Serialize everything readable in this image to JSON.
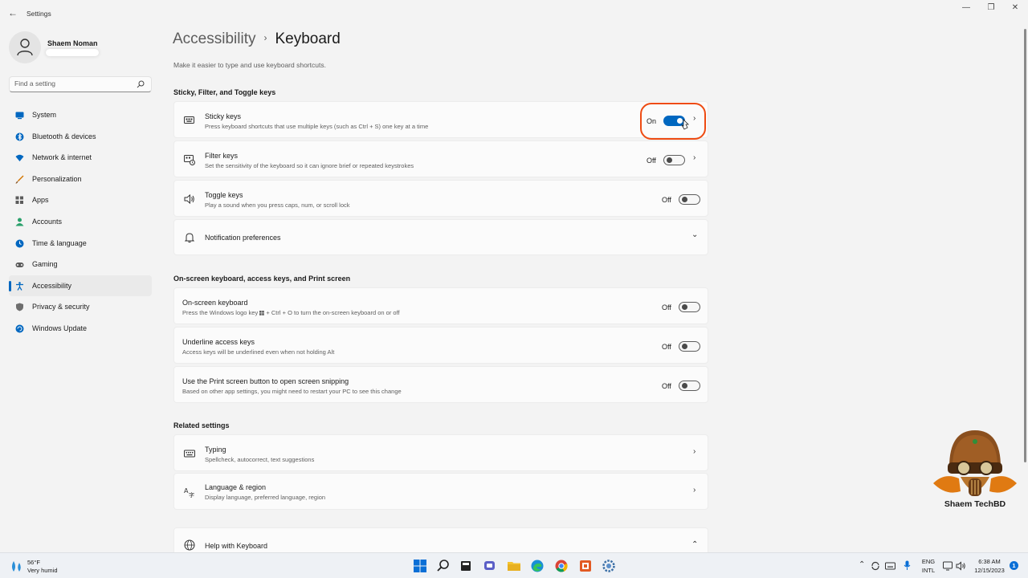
{
  "window": {
    "title": "Settings",
    "back_glyph": "←",
    "min_glyph": "—",
    "max_glyph": "❐",
    "close_glyph": "✕"
  },
  "profile": {
    "name": "Shaem Noman"
  },
  "search": {
    "placeholder": "Find a setting"
  },
  "sidebar": {
    "items": [
      {
        "label": "System",
        "icon": "system-icon",
        "color": "#0067c0"
      },
      {
        "label": "Bluetooth & devices",
        "icon": "bluetooth-icon",
        "color": "#0067c0"
      },
      {
        "label": "Network & internet",
        "icon": "wifi-icon",
        "color": "#0067c0"
      },
      {
        "label": "Personalization",
        "icon": "brush-icon",
        "color": "#d47500"
      },
      {
        "label": "Apps",
        "icon": "apps-icon",
        "color": "#5c5c5c"
      },
      {
        "label": "Accounts",
        "icon": "accounts-icon",
        "color": "#2aa06b"
      },
      {
        "label": "Time & language",
        "icon": "globe-clock-icon",
        "color": "#0067c0"
      },
      {
        "label": "Gaming",
        "icon": "gamepad-icon",
        "color": "#5c5c5c"
      },
      {
        "label": "Accessibility",
        "icon": "accessibility-icon",
        "color": "#0067c0",
        "active": true
      },
      {
        "label": "Privacy & security",
        "icon": "shield-icon",
        "color": "#5c5c5c"
      },
      {
        "label": "Windows Update",
        "icon": "update-icon",
        "color": "#0067c0"
      }
    ]
  },
  "header": {
    "parent": "Accessibility",
    "separator": "›",
    "current": "Keyboard",
    "subtitle": "Make it easier to type and use keyboard shortcuts."
  },
  "sections": {
    "sticky": {
      "heading": "Sticky, Filter, and Toggle keys",
      "sticky_keys": {
        "title": "Sticky keys",
        "desc": "Press keyboard shortcuts that use multiple keys (such as Ctrl + S) one key at a time",
        "state": "On"
      },
      "filter_keys": {
        "title": "Filter keys",
        "desc": "Set the sensitivity of the keyboard so it can ignore brief or repeated keystrokes",
        "state": "Off"
      },
      "toggle_keys": {
        "title": "Toggle keys",
        "desc": "Play a sound when you press caps, num, or scroll lock",
        "state": "Off"
      },
      "notification": {
        "title": "Notification preferences"
      }
    },
    "onscreen": {
      "heading": "On-screen keyboard, access keys, and Print screen",
      "osk": {
        "title": "On-screen keyboard",
        "desc_before": "Press the Windows logo key",
        "desc_after": "+ Ctrl + O to turn the on-screen keyboard on or off",
        "state": "Off"
      },
      "underline": {
        "title": "Underline access keys",
        "desc": "Access keys will be underlined even when not holding Alt",
        "state": "Off"
      },
      "printscreen": {
        "title": "Use the Print screen button to open screen snipping",
        "desc": "Based on other app settings, you might need to restart your PC to see this change",
        "state": "Off"
      }
    },
    "related": {
      "heading": "Related settings",
      "typing": {
        "title": "Typing",
        "desc": "Spellcheck, autocorrect, text suggestions"
      },
      "language": {
        "title": "Language & region",
        "desc": "Display language, preferred language, region"
      },
      "help": {
        "title": "Help with Keyboard"
      }
    }
  },
  "chevrons": {
    "right": "›",
    "down": "⌄",
    "up": "⌃"
  },
  "watermark": {
    "text": "Shaem TechBD"
  },
  "taskbar": {
    "weather": {
      "temp": "56°F",
      "desc": "Very humid"
    },
    "lang": {
      "line1": "ENG",
      "line2": "INTL"
    },
    "clock": {
      "time": "6:38 AM",
      "date": "12/15/2023"
    },
    "notifications": "1",
    "tray_up": "⌃",
    "accent": "#0067c0"
  }
}
